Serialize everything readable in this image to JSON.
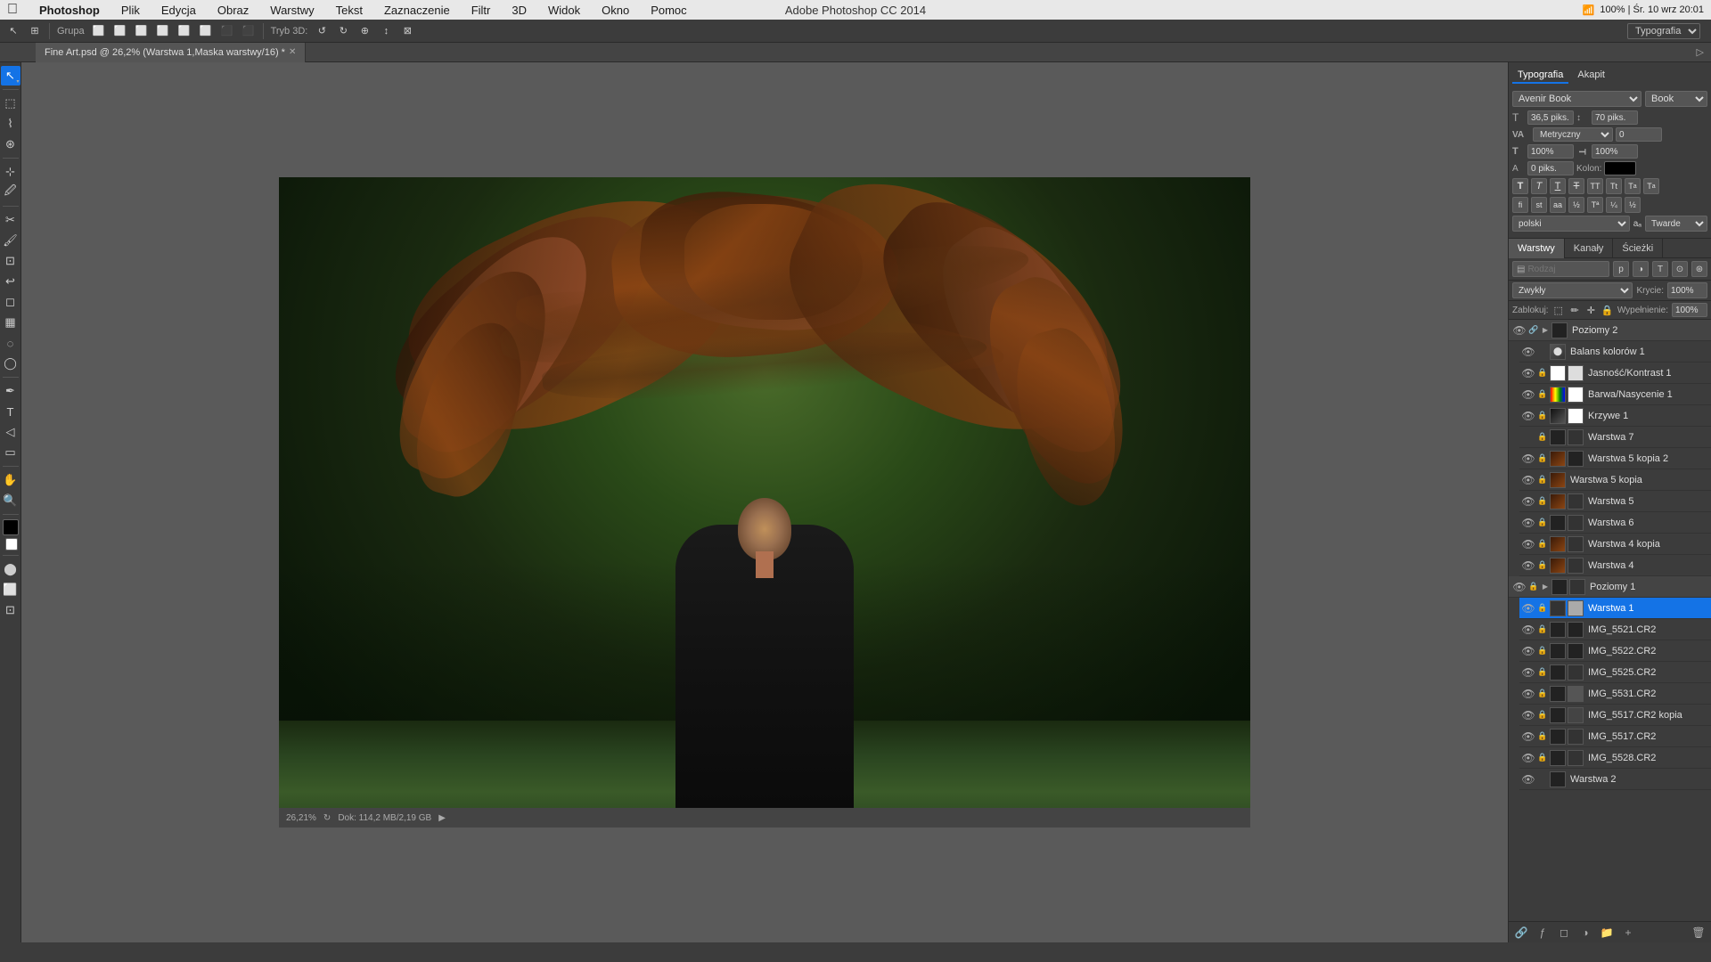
{
  "app": {
    "name": "Photoshop",
    "title": "Adobe Photoshop CC 2014",
    "workspace": "Typografia"
  },
  "menu": {
    "apple": "⌘",
    "items": [
      "Photoshop",
      "Plik",
      "Edycja",
      "Obraz",
      "Warstwy",
      "Tekst",
      "Zaznaczenie",
      "Filtr",
      "3D",
      "Widok",
      "Okno",
      "Pomoc"
    ],
    "right_info": "100% | Śr. 10 wrz 20:01"
  },
  "toolbar": {
    "group_label": "Grupa",
    "mode_3d": "Tryb 3D:",
    "workspace": "Typografia"
  },
  "file_tab": {
    "name": "Fine Art.psd @ 26,2% (Warstwa 1,Maska warstwy/16) *"
  },
  "typography": {
    "panel_title": "Typografia",
    "tab_akapit": "Akapit",
    "font_family": "Avenir Book",
    "font_style": "Book",
    "font_size": "36,5 piks.",
    "leading": "70 piks.",
    "tracking_label": "VA",
    "tracking_value": "Metryczny",
    "tracking_number": "0",
    "scale_h": "100%",
    "scale_v": "100%",
    "kerning_label": "T",
    "baseline_label": "0 piks.",
    "color_label": "Kolon:",
    "language": "polski",
    "antialiasing": "Twarde",
    "format_buttons": [
      "T",
      "T",
      "T",
      "T",
      "T",
      "T",
      "T",
      "T"
    ]
  },
  "layers": {
    "panel_title": "Warstwy",
    "tab_channels": "Kanały",
    "tab_paths": "Ścieżki",
    "search_placeholder": "Rodzaj",
    "blend_mode": "Zwykły",
    "opacity_label": "Krycie:",
    "opacity_value": "100%",
    "fill_label": "Wypełnienie:",
    "fill_value": "100%",
    "lock_label": "Zablokuj:",
    "items": [
      {
        "id": 1,
        "name": "Poziomy 2",
        "type": "group",
        "visible": true,
        "locked": false,
        "indent": 0
      },
      {
        "id": 2,
        "name": "Balans kolorów 1",
        "type": "adjustment",
        "visible": true,
        "locked": false,
        "indent": 1
      },
      {
        "id": 3,
        "name": "Jasność/Kontrast 1",
        "type": "adjustment",
        "visible": true,
        "locked": false,
        "indent": 1
      },
      {
        "id": 4,
        "name": "Barwa/Nasycenie 1",
        "type": "adjustment",
        "visible": true,
        "locked": false,
        "indent": 1
      },
      {
        "id": 5,
        "name": "Krzywe 1",
        "type": "adjustment",
        "visible": true,
        "locked": false,
        "indent": 1
      },
      {
        "id": 6,
        "name": "Warstwa 7",
        "type": "layer",
        "visible": true,
        "locked": false,
        "indent": 1
      },
      {
        "id": 7,
        "name": "Warstwa 5 kopia 2",
        "type": "layer",
        "visible": true,
        "locked": false,
        "indent": 1
      },
      {
        "id": 8,
        "name": "Warstwa 5 kopia",
        "type": "layer",
        "visible": true,
        "locked": false,
        "indent": 1
      },
      {
        "id": 9,
        "name": "Warstwa 5",
        "type": "layer",
        "visible": true,
        "locked": false,
        "indent": 1
      },
      {
        "id": 10,
        "name": "Warstwa 6",
        "type": "layer",
        "visible": true,
        "locked": false,
        "indent": 1
      },
      {
        "id": 11,
        "name": "Warstwa 4 kopia",
        "type": "layer",
        "visible": true,
        "locked": false,
        "indent": 1
      },
      {
        "id": 12,
        "name": "Warstwa 4",
        "type": "layer",
        "visible": true,
        "locked": false,
        "indent": 1
      },
      {
        "id": 13,
        "name": "Poziomy 1",
        "type": "group",
        "visible": true,
        "locked": false,
        "indent": 0
      },
      {
        "id": 14,
        "name": "Warstwa 1",
        "type": "layer",
        "visible": true,
        "locked": false,
        "selected": true,
        "indent": 1
      },
      {
        "id": 15,
        "name": "IMG_5521.CR2",
        "type": "layer",
        "visible": true,
        "locked": true,
        "indent": 1
      },
      {
        "id": 16,
        "name": "IMG_5522.CR2",
        "type": "layer",
        "visible": true,
        "locked": true,
        "indent": 1
      },
      {
        "id": 17,
        "name": "IMG_5525.CR2",
        "type": "layer",
        "visible": true,
        "locked": true,
        "indent": 1
      },
      {
        "id": 18,
        "name": "IMG_5531.CR2",
        "type": "layer",
        "visible": true,
        "locked": true,
        "indent": 1
      },
      {
        "id": 19,
        "name": "IMG_5517.CR2 kopia",
        "type": "layer",
        "visible": true,
        "locked": true,
        "indent": 1
      },
      {
        "id": 20,
        "name": "IMG_5517.CR2",
        "type": "layer",
        "visible": true,
        "locked": true,
        "indent": 1
      },
      {
        "id": 21,
        "name": "IMG_5528.CR2",
        "type": "layer",
        "visible": true,
        "locked": true,
        "indent": 1
      },
      {
        "id": 22,
        "name": "Warstwa 2",
        "type": "layer",
        "visible": true,
        "locked": false,
        "indent": 1
      }
    ]
  },
  "status": {
    "zoom": "26,21%",
    "doc_size": "Dok: 114,2 MB/2,19 GB"
  },
  "canvas": {
    "zoom_percent": "26,21%"
  }
}
